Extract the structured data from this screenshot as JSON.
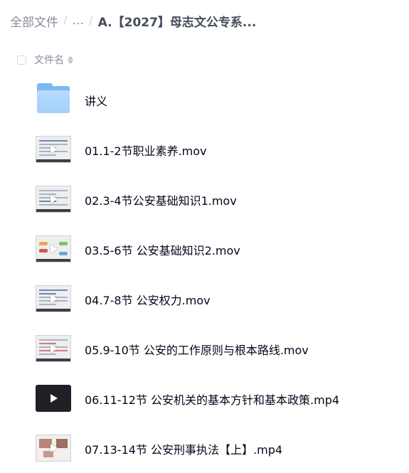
{
  "breadcrumb": {
    "root": "全部文件",
    "separator": "/",
    "ellipsis": "...",
    "current": "A.【2027】母志文公专系..."
  },
  "list_header": {
    "name_label": "文件名"
  },
  "files": [
    {
      "name": "讲义",
      "type": "folder",
      "icon": "folder-icon"
    },
    {
      "name": "01.1-2节职业素养.mov",
      "type": "video",
      "icon": "video-thumbnail"
    },
    {
      "name": "02.3-4节公安基础知识1.mov",
      "type": "video",
      "icon": "video-thumbnail"
    },
    {
      "name": "03.5-6节 公安基础知识2.mov",
      "type": "video",
      "icon": "video-thumbnail"
    },
    {
      "name": "04.7-8节 公安权力.mov",
      "type": "video",
      "icon": "video-thumbnail"
    },
    {
      "name": "05.9-10节 公安的工作原则与根本路线.mov",
      "type": "video",
      "icon": "video-thumbnail"
    },
    {
      "name": "06.11-12节 公安机关的基本方针和基本政策.mp4",
      "type": "video",
      "icon": "video-thumbnail-dark"
    },
    {
      "name": "07.13-14节 公安刑事执法【上】.mp4",
      "type": "video",
      "icon": "video-thumbnail"
    }
  ],
  "colors": {
    "text_primary": "#03081a",
    "text_secondary": "#878c9c",
    "folder_blue": "#7cb8f3"
  }
}
